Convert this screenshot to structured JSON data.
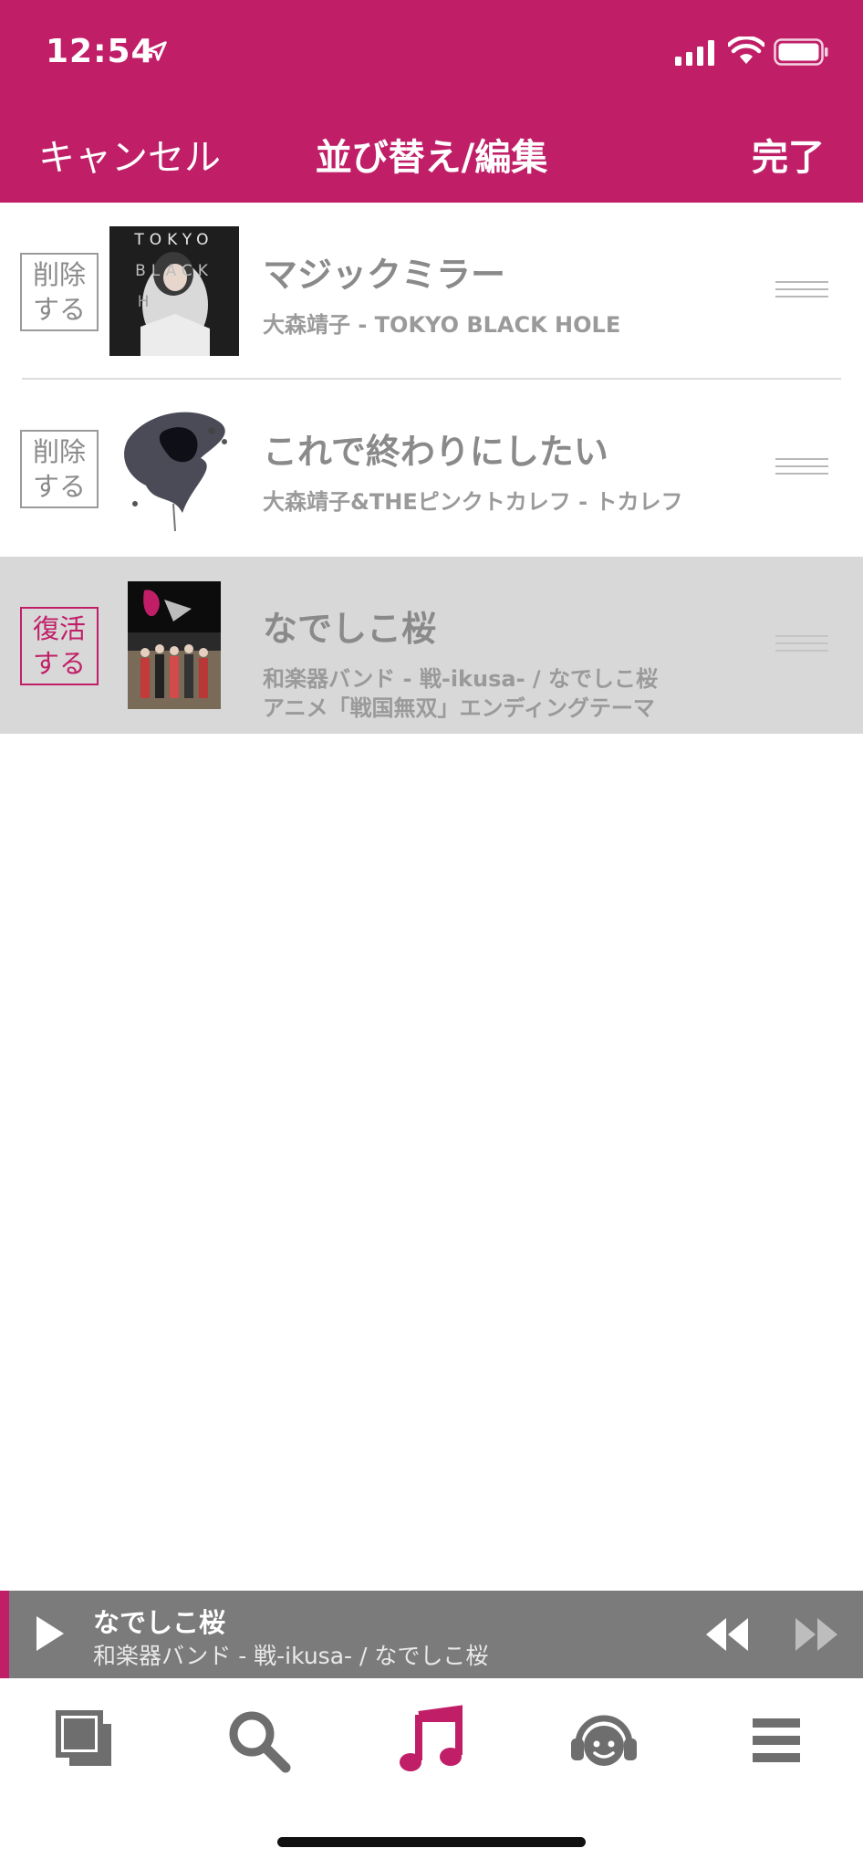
{
  "status_bar": {
    "time": "12:54"
  },
  "nav": {
    "cancel_label": "キャンセル",
    "title": "並び替え/編集",
    "done_label": "完了"
  },
  "rows": [
    {
      "action_label": "削除\nする",
      "title": "マジックミラー",
      "subtitle": "大森靖子 - TOKYO BLACK HOLE",
      "subtitle2": "",
      "art_text": [
        "T O K Y O",
        "B L A C K",
        "H O L E"
      ],
      "state": "active"
    },
    {
      "action_label": "削除\nする",
      "title": "これで終わりにしたい",
      "subtitle": "大森靖子&THEピンクトカレフ - トカレフ",
      "subtitle2": "",
      "state": "active"
    },
    {
      "action_label": "復活\nする",
      "title": "なでしこ桜",
      "subtitle": "和楽器バンド - 戦-ikusa- / なでしこ桜",
      "subtitle2": "アニメ「戦国無双」エンディングテーマ",
      "state": "deleted"
    }
  ],
  "now_playing": {
    "title": "なでしこ桜",
    "subtitle": "和楽器バンド - 戦-ikusa- / なでしこ桜"
  },
  "tabs": [
    {
      "icon": "library-icon",
      "active": false
    },
    {
      "icon": "search-icon",
      "active": false
    },
    {
      "icon": "music-note-icon",
      "active": true
    },
    {
      "icon": "headphones-icon",
      "active": false
    },
    {
      "icon": "menu-icon",
      "active": false
    }
  ],
  "colors": {
    "brand": "#c01f68",
    "mini_player_bg": "#7b7b7b",
    "deleted_row_bg": "#d8d8d8",
    "inactive_icon": "#6e6e6e"
  }
}
